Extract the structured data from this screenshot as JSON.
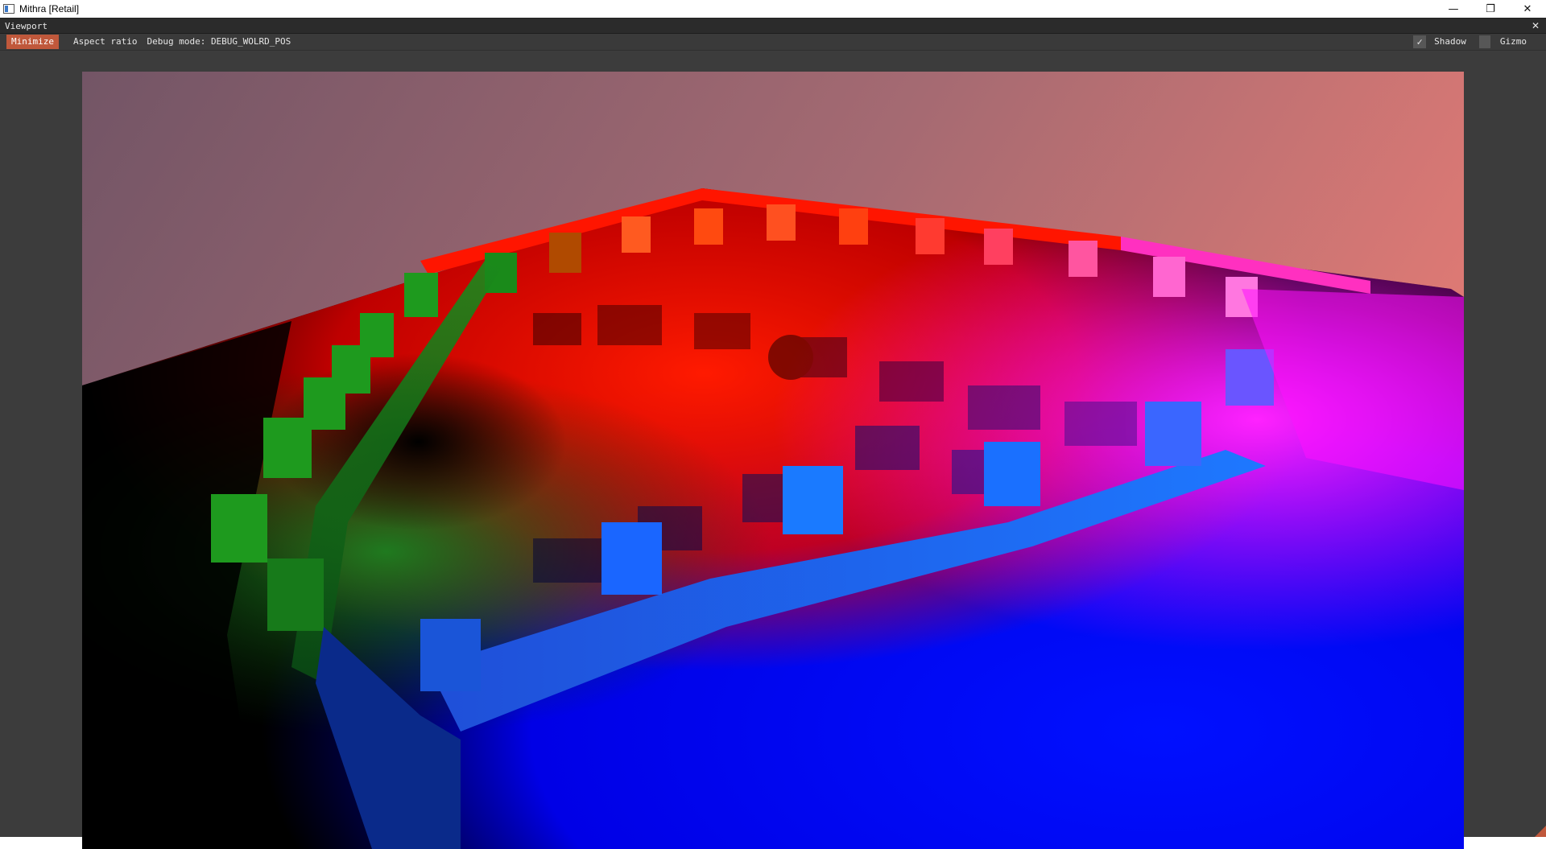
{
  "window": {
    "title": "Mithra [Retail]",
    "controls": {
      "minimize": "—",
      "restore": "❐",
      "close": "✕"
    }
  },
  "panel": {
    "title": "Viewport",
    "close": "✕"
  },
  "toolbar": {
    "minimize_label": "Minimize",
    "aspect_ratio_label": "Aspect ratio",
    "debug_mode_label": "Debug mode: DEBUG_WOLRD_POS",
    "shadow": {
      "label": "Shadow",
      "checked": true,
      "check_glyph": "✓"
    },
    "gizmo_label": "Gizmo"
  },
  "colors": {
    "accent": "#c0583b",
    "panel_bg": "#3c3c3c",
    "header_bg": "#2b2b2b",
    "sky_top": "#7a5a6e",
    "sky_right": "#e07a76",
    "world_red": "#ff0000",
    "world_green": "#00ff00",
    "world_blue": "#0000ff"
  },
  "icons": {
    "app": "app-icon",
    "check": "check-icon",
    "resize": "resize-grip-icon"
  }
}
